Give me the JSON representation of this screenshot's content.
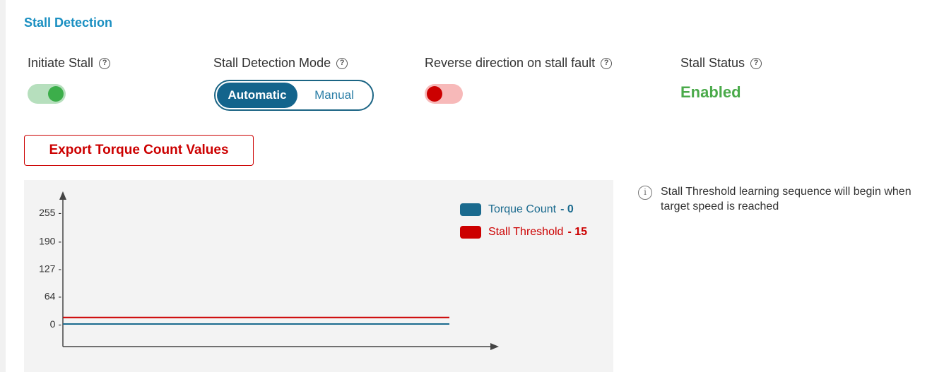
{
  "section": {
    "title": "Stall Detection"
  },
  "controls": {
    "initiate_stall": {
      "label": "Initiate Stall",
      "on": true
    },
    "detection_mode": {
      "label": "Stall Detection Mode",
      "options": [
        "Automatic",
        "Manual"
      ],
      "selected": "Automatic"
    },
    "reverse_direction": {
      "label": "Reverse direction on stall fault",
      "on": false
    },
    "stall_status": {
      "label": "Stall Status",
      "value": "Enabled"
    }
  },
  "export_button": {
    "label": "Export Torque Count Values"
  },
  "info_note": {
    "text": "Stall Threshold learning sequence will begin when target speed is reached",
    "icon": "info-icon"
  },
  "icons": {
    "help": "help-icon",
    "info": "info-icon"
  },
  "colors": {
    "accent": "#1a8fc1",
    "torque": "#1a6a8e",
    "threshold": "#cc0000",
    "enabled": "#4aaa4a"
  },
  "chart_data": {
    "type": "line",
    "title": "",
    "xlabel": "",
    "ylabel": "",
    "ylim": [
      0,
      255
    ],
    "yticks": [
      "255 -",
      "190 -",
      "127 -",
      "64 -",
      "0 -"
    ],
    "ytick_values": [
      255,
      190,
      127,
      64,
      0
    ],
    "series": [
      {
        "name": "Torque Count",
        "legend_value": "- 0",
        "color": "#1a6a8e",
        "values": [
          0,
          0
        ]
      },
      {
        "name": "Stall Threshold",
        "legend_value": "- 15",
        "color": "#cc0000",
        "values": [
          15,
          15
        ]
      }
    ],
    "grid": false,
    "legend_position": "top-right"
  }
}
